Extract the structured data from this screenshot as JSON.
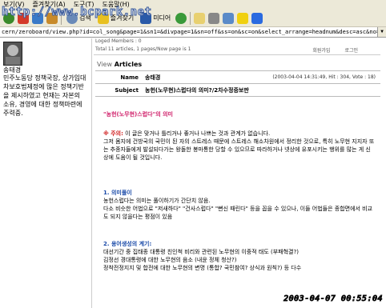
{
  "menu": [
    "보기(V)",
    "즐겨찾기(A)",
    "도구(T)",
    "도움말(H)"
  ],
  "watermark_url": "http://www.bcpark.net",
  "toolbar": {
    "search_label": "검색",
    "favorites_label": "즐겨찾기",
    "media_label": "미디어"
  },
  "address": "cern/zeroboard/view.php?id=col_song&page=1&sn1=&divpage=1&sn=off&ss=on&sc=on&select_arrange=headnum&desc=asc&no=16",
  "sidebar": {
    "name": "송태경",
    "bio": "민주노동당 정책국장, 상가임대차보호법제정에 많은 정책기반을 제시하였고 현재는 자본의 소유, 경영에 대한 정책마련에 주력중."
  },
  "main": {
    "logged_members": "Loged Members : 0",
    "total_line": "Total  11  articles,  1  pages/Now page is  1",
    "links": [
      "회원가입",
      "로그인"
    ],
    "view_title": "View",
    "view_articles": "Articles",
    "name_label": "Name",
    "name_value": "송태경",
    "meta": "(2003-04-04 14:31:49, Hit : 304, Vote : 18)",
    "subject_label": "Subject",
    "subject_value": "농헌(노무현)스럽다의 의미?/2차수정증보판",
    "heading": "\"농헌(노무현)스럽다\"의 의미",
    "note_mark": "※ 주의:",
    "note_text": "이 글은 맞거나 틀리거나 좋거나 나쁘는 것과 관계가 없습니다.",
    "para1": "그저 몸지에 건방국의 국민이 된 자의 스트레스 때문에 스트레스 해소차원에서 정리한 것으로, 특히 노무현 지지자 또는 추종자들에게 발설되다가는 왕돌한 봉마통한 당할 수 있으므로 따라하거나 넷상에 유포시키는 행위를 많는 게 신상에 도움이 될 것입니다.",
    "sec1_title": "1. 의미풀이",
    "sec1_text1": "농헌스럽다는 의미는 풀이하기가 간단치 않음.",
    "sec1_text2": "다소 비슷한 어법으로 \"저새하다\" \"건사스럽다\" \"뻔신 때린다\" 등을 꼽을 수 있으나, 이들 어법들은 종합면에서 비교도 되지 않을다는 평점이 있음",
    "sec2_title": "2. 용어생성의 계기:",
    "sec2_text1": "대선기간 중 집태종 대통령 친인척 비리와 관련된 노무현의 이중적 태도 (부패혁결?)",
    "sec2_text2": "김정선 경대통령에 대한 노무현의 음소 (내윤 정체 청산?)",
    "sec2_text3": "정착전정지지 및 합전에 대한 노무현의 변명 (통합? 국민참여? 상식과 원칙?) 등 다수"
  },
  "datestamp": "2003-04-07 00:55:04"
}
